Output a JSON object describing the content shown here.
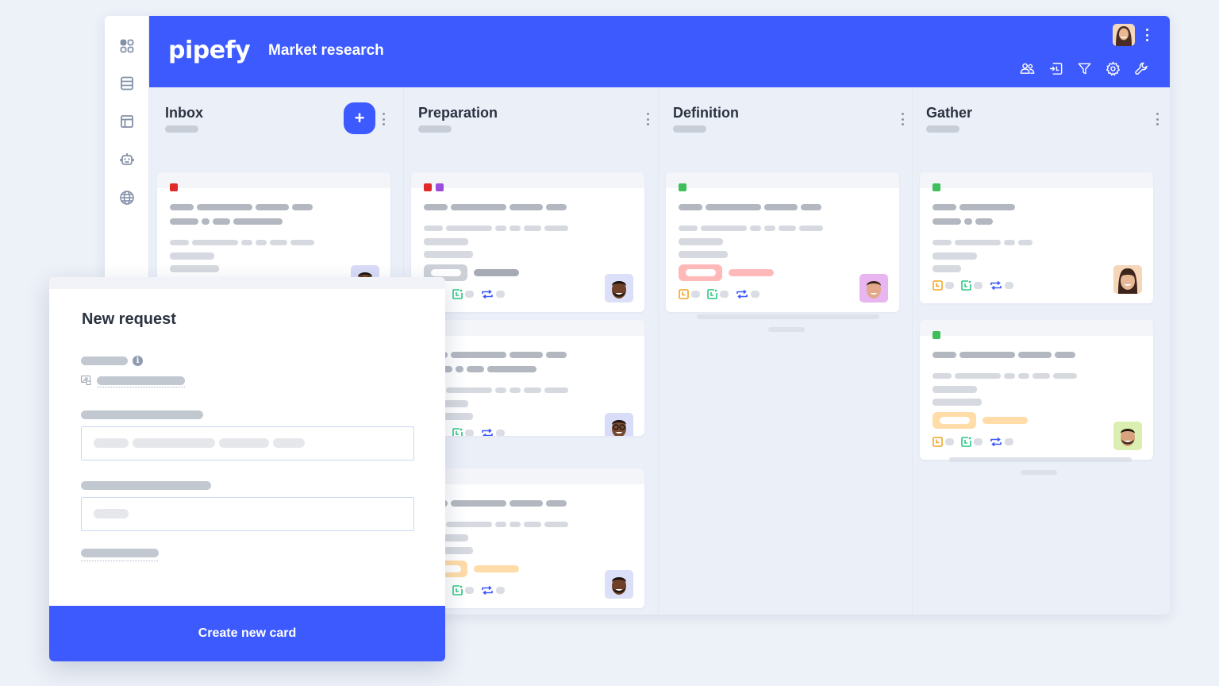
{
  "app": {
    "logo": "pipefy",
    "pipe_title": "Market research",
    "sidebar_icons": [
      "apps-grid-icon",
      "database-icon",
      "layout-icon",
      "robot-icon",
      "globe-icon"
    ],
    "header_tools": [
      "members-icon",
      "import-icon",
      "filter-icon",
      "settings-gear-icon",
      "wrench-icon"
    ],
    "brand_color": "#3d5afe"
  },
  "columns": [
    {
      "title": "Inbox",
      "has_add_button": true,
      "add_label": "+"
    },
    {
      "title": "Preparation",
      "has_add_button": false
    },
    {
      "title": "Definition",
      "has_add_button": false
    },
    {
      "title": "Gather",
      "has_add_button": false
    }
  ],
  "label_colors": {
    "red": "#e02a2a",
    "purple": "#9b4ddb",
    "green": "#3fbf5a"
  },
  "tag_colors": {
    "gray": {
      "pill": "#cdd1d7",
      "bar": "#a6abb3"
    },
    "red": {
      "pill": "#ffb9b9",
      "bar": "#ffb9b9"
    },
    "orange": {
      "pill": "#ffdca8",
      "bar": "#ffdca8"
    }
  },
  "cards": [
    {
      "column": 0,
      "labels": [
        "red"
      ],
      "tag": null,
      "avatar": "person-glasses"
    },
    {
      "column": 1,
      "labels": [
        "red",
        "purple"
      ],
      "tag": "gray",
      "avatar": "person-beard"
    },
    {
      "column": 1,
      "labels": [],
      "tag": null,
      "avatar": "person-glasses"
    },
    {
      "column": 1,
      "labels": [],
      "tag": "orange",
      "avatar": "person-beard"
    },
    {
      "column": 2,
      "labels": [
        "green"
      ],
      "tag": "red",
      "avatar": "person-man-smile"
    },
    {
      "column": 3,
      "labels": [
        "green"
      ],
      "tag": null,
      "avatar": "person-woman"
    },
    {
      "column": 3,
      "labels": [
        "green"
      ],
      "tag": "orange",
      "avatar": "person-man-stubble"
    }
  ],
  "modal": {
    "title": "New request",
    "submit_label": "Create new card"
  }
}
